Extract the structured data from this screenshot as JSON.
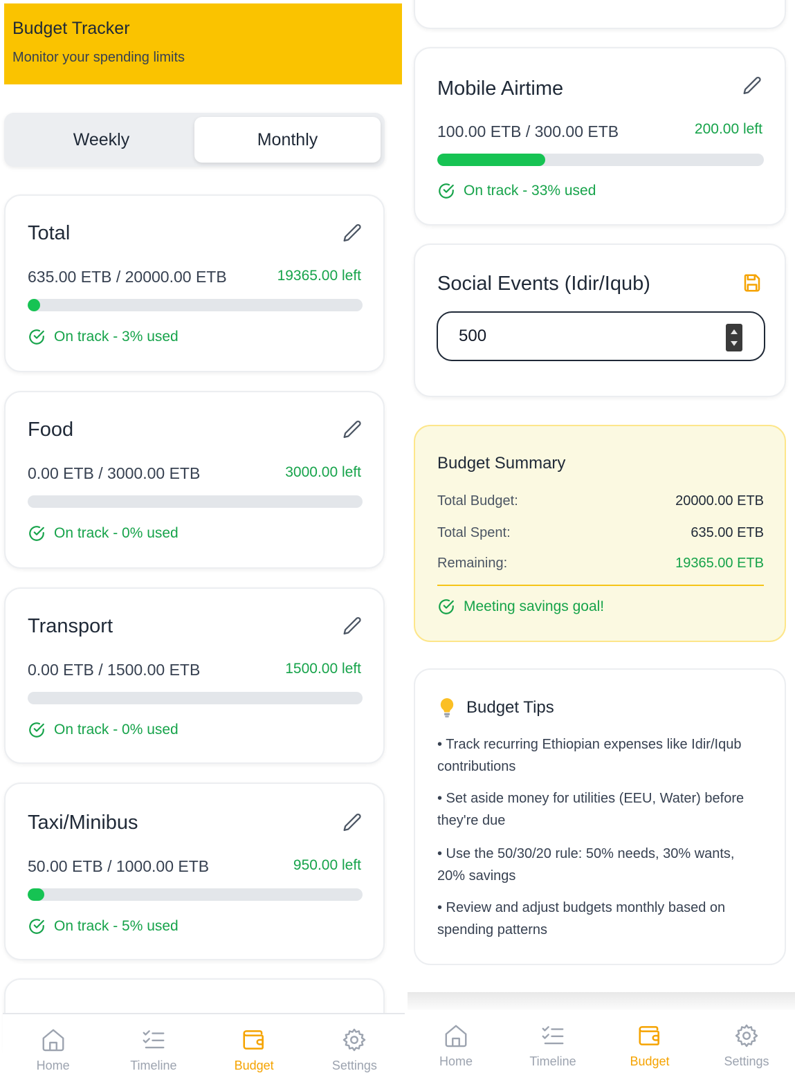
{
  "header": {
    "title": "Budget Tracker",
    "subtitle": "Monitor your spending limits"
  },
  "period_toggle": {
    "options": [
      "Weekly",
      "Monthly"
    ],
    "active": "Monthly"
  },
  "categories": [
    {
      "name": "Total",
      "amount": "635.00 ETB / 20000.00 ETB",
      "left": "19365.00 left",
      "progress_fraction": 0.03,
      "status": "On track - 3% used"
    },
    {
      "name": "Food",
      "amount": "0.00 ETB / 3000.00 ETB",
      "left": "3000.00 left",
      "progress_fraction": 0,
      "status": "On track - 0% used"
    },
    {
      "name": "Transport",
      "amount": "0.00 ETB / 1500.00 ETB",
      "left": "1500.00 left",
      "progress_fraction": 0,
      "status": "On track - 0% used"
    },
    {
      "name": "Taxi/Minibus",
      "amount": "50.00 ETB / 1000.00 ETB",
      "left": "950.00 left",
      "progress_fraction": 0.05,
      "status": "On track - 5% used"
    },
    {
      "name": "Mobile Airtime",
      "amount": "100.00 ETB / 300.00 ETB",
      "left": "200.00 left",
      "progress_fraction": 0.33,
      "status": "On track - 33% used"
    }
  ],
  "social_events": {
    "name": "Social Events (Idir/Iqub)",
    "input_value": "500"
  },
  "summary": {
    "title": "Budget Summary",
    "total_budget_label": "Total Budget:",
    "total_budget_value": "20000.00 ETB",
    "total_spent_label": "Total Spent:",
    "total_spent_value": "635.00 ETB",
    "remaining_label": "Remaining:",
    "remaining_value": "19365.00 ETB",
    "status": "Meeting savings goal!"
  },
  "tips": {
    "title": "Budget Tips",
    "items": [
      "• Track recurring Ethiopian expenses like Idir/Iqub contributions",
      "• Set aside money for utilities (EEU, Water) before they're due",
      "• Use the 50/30/20 rule: 50% needs, 30% wants, 20% savings",
      "• Review and adjust budgets monthly based on spending patterns"
    ]
  },
  "nav": {
    "home": "Home",
    "timeline": "Timeline",
    "budget": "Budget",
    "settings": "Settings",
    "active": "Budget"
  },
  "colors": {
    "header_bg": "#fac300",
    "accent": "#f5a300",
    "success": "#16a34a",
    "progress": "#16c353",
    "summary_bg": "#fbf9e1"
  }
}
